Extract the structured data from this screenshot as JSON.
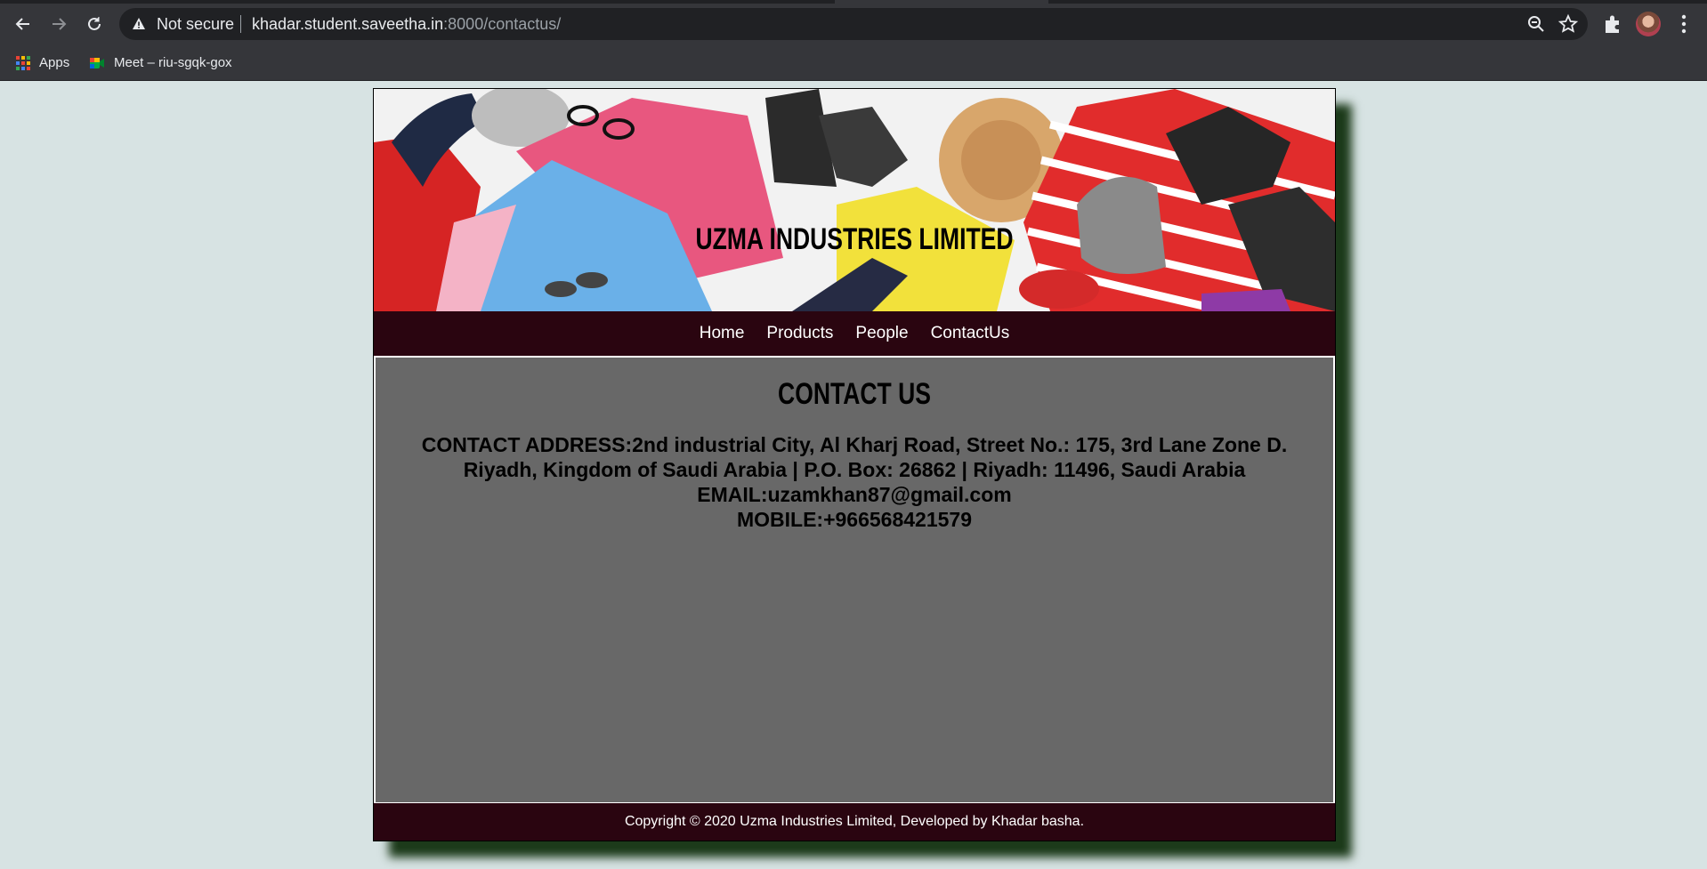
{
  "browser": {
    "security_label": "Not secure",
    "url_host": "khadar.student.saveetha.in",
    "url_rest": ":8000/contactus/",
    "bookmarks": [
      {
        "label": "Apps",
        "icon": "apps-grid-icon"
      },
      {
        "label": "Meet – riu-sgqk-gox",
        "icon": "google-meet-icon"
      }
    ]
  },
  "site": {
    "banner_title": "UZMA INDUSTRIES LIMITED",
    "nav": [
      "Home",
      "Products",
      "People",
      "ContactUs"
    ],
    "heading": "CONTACT US",
    "address_line1": "CONTACT ADDRESS:2nd industrial City, Al Kharj Road, Street No.: 175, 3rd Lane Zone D.",
    "address_line2": "Riyadh, Kingdom of Saudi Arabia | P.O. Box: 26862 | Riyadh: 11496, Saudi Arabia",
    "email_line": "EMAIL:uzamkhan87@gmail.com",
    "mobile_line": "MOBILE:+966568421579",
    "footer": "Copyright © 2020 Uzma Industries Limited, Developed by Khadar basha."
  },
  "colors": {
    "page_bg": "#d7e3e3",
    "nav_bg": "#2a0510",
    "content_bg": "#686868",
    "shadow": "#1c3a1a"
  }
}
